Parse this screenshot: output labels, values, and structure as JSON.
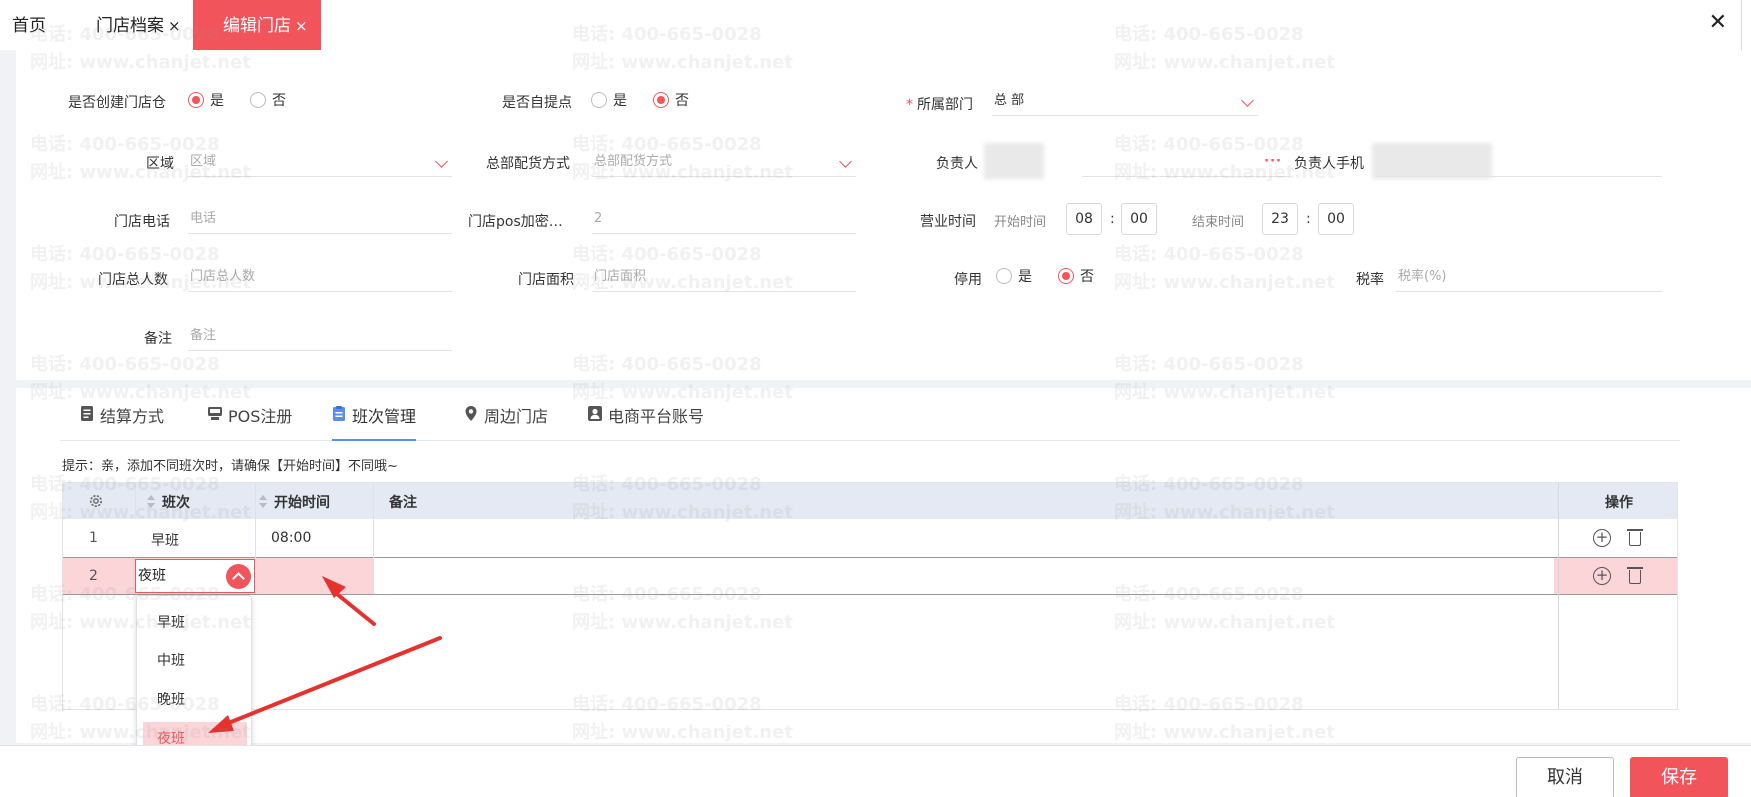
{
  "tabs": {
    "home": "首页",
    "store_archive": "门店档案",
    "edit_store": "编辑门店",
    "close_glyph": "×"
  },
  "window": {
    "close_glyph": "✕"
  },
  "watermark": {
    "phone": "电话: 400-665-0028",
    "site": "网址: www.chanjet.net"
  },
  "form": {
    "create_warehouse": {
      "label": "是否创建门店仓",
      "options": [
        "是",
        "否"
      ],
      "selected": "是"
    },
    "self_pickup": {
      "label": "是否自提点",
      "options": [
        "是",
        "否"
      ],
      "selected": "否"
    },
    "department": {
      "label": "所属部门",
      "required_mark": "*",
      "value": "总 部"
    },
    "region": {
      "label": "区域",
      "placeholder": "区域"
    },
    "hq_delivery": {
      "label": "总部配货方式",
      "placeholder": "总部配货方式"
    },
    "manager": {
      "label": "负责人",
      "dots": "···"
    },
    "manager_phone": {
      "label": "负责人手机"
    },
    "store_phone": {
      "label": "门店电话",
      "placeholder": "电话"
    },
    "pos_encrypt": {
      "label": "门店pos加密…",
      "value": "2"
    },
    "business_hours": {
      "label": "营业时间",
      "start_label": "开始时间",
      "start_hour": "08",
      "start_min": "00",
      "end_label": "结束时间",
      "end_hour": "23",
      "end_min": "00",
      "colon": ":"
    },
    "staff_count": {
      "label": "门店总人数",
      "placeholder": "门店总人数"
    },
    "store_area": {
      "label": "门店面积",
      "placeholder": "门店面积"
    },
    "disabled": {
      "label": "停用",
      "options": [
        "是",
        "否"
      ],
      "selected": "否"
    },
    "tax_rate": {
      "label": "税率",
      "placeholder": "税率(%)"
    },
    "remark": {
      "label": "备注",
      "placeholder": "备注"
    }
  },
  "subtabs": [
    "结算方式",
    "POS注册",
    "班次管理",
    "周边门店",
    "电商平台账号"
  ],
  "active_subtab": "班次管理",
  "hint": "提示：亲，添加不同班次时，请确保【开始时间】不同哦~",
  "grid": {
    "columns": [
      "班次",
      "开始时间",
      "备注",
      "操作"
    ],
    "rows": [
      {
        "index": "1",
        "shift": "早班",
        "start": "08:00",
        "remark": ""
      },
      {
        "index": "2",
        "shift": "夜班",
        "start": "",
        "remark": ""
      }
    ]
  },
  "dropdown": {
    "options": [
      "早班",
      "中班",
      "晚班",
      "夜班"
    ],
    "selected": "夜班"
  },
  "footer": {
    "cancel": "取消",
    "save": "保存"
  },
  "colors": {
    "accent": "#f2545b",
    "header_bg": "#e4e9f3",
    "row_highlight": "#fbd5d8",
    "tab_underline": "#5b8def"
  }
}
